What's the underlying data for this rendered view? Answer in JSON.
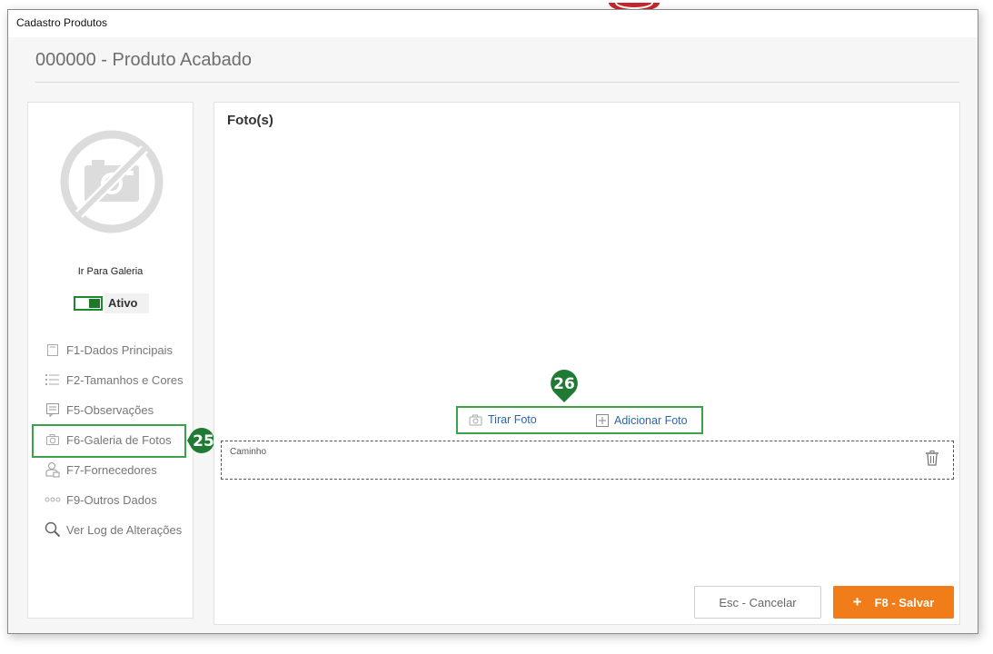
{
  "window": {
    "title": "Cadastro Produtos"
  },
  "page": {
    "title": "000000 - Produto Acabado"
  },
  "sidebar": {
    "gallery_link": "Ir Para Galeria",
    "status_label": "Ativo",
    "items": [
      {
        "label": "F1-Dados Principais",
        "icon": "document-icon"
      },
      {
        "label": "F2-Tamanhos  e Cores",
        "icon": "list-icon"
      },
      {
        "label": "F5-Observações",
        "icon": "notes-icon"
      },
      {
        "label": "F6-Galeria de Fotos",
        "icon": "camera-icon",
        "active": true
      },
      {
        "label": "F7-Fornecedores",
        "icon": "supplier-icon"
      },
      {
        "label": "F9-Outros Dados",
        "icon": "more-icon"
      },
      {
        "label": "Ver Log de Alterações",
        "icon": "search-icon"
      }
    ]
  },
  "main": {
    "section_title": "Foto(s)",
    "take_photo": "Tirar Foto",
    "add_photo": "Adicionar Foto",
    "path_label": "Caminho"
  },
  "footer": {
    "cancel_label": "Esc - Cancelar",
    "save_label": "F8 - Salvar"
  },
  "annotations": {
    "badge_sidebar": "25",
    "badge_actions": "26"
  },
  "colors": {
    "accent_green": "#1f8a3a",
    "highlight_green": "#3aa34a",
    "save_orange": "#f07d1a",
    "link_blue": "#2a67b1"
  }
}
